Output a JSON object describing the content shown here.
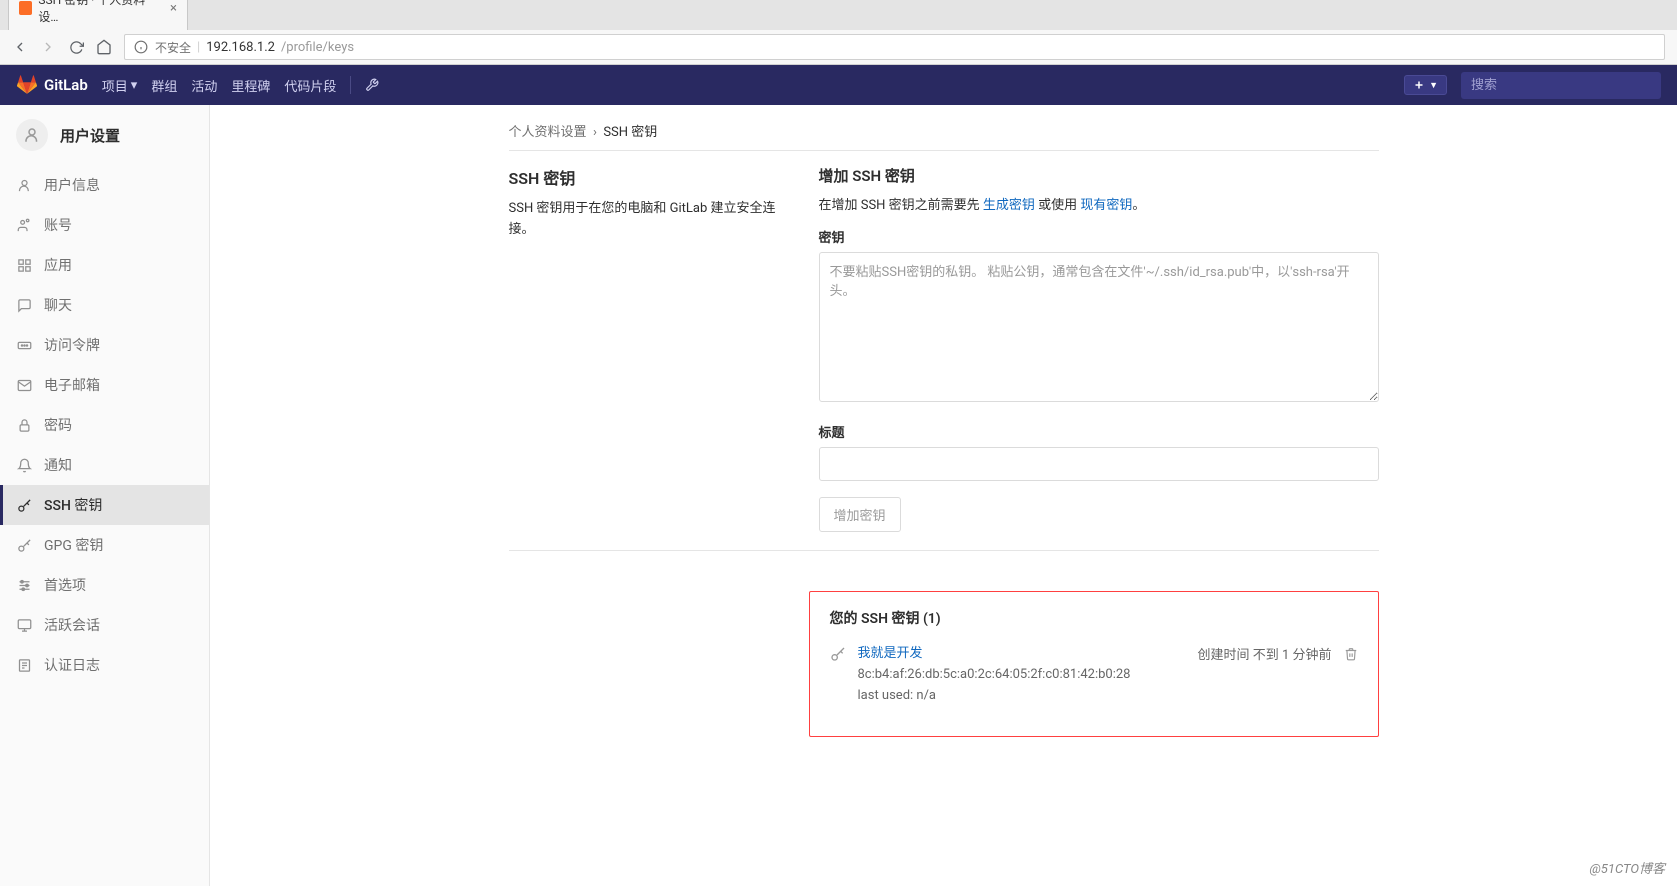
{
  "browser": {
    "tab_title": "SSH 密钥 · 个人资料设…",
    "security_label": "不安全",
    "url_host": "192.168.1.2",
    "url_path": "/profile/keys"
  },
  "header": {
    "brand": "GitLab",
    "nav": {
      "projects": "项目",
      "groups": "群组",
      "activity": "活动",
      "milestones": "里程碑",
      "snippets": "代码片段"
    },
    "search_placeholder": "搜索"
  },
  "sidebar": {
    "title": "用户设置",
    "items": [
      {
        "label": "用户信息"
      },
      {
        "label": "账号"
      },
      {
        "label": "应用"
      },
      {
        "label": "聊天"
      },
      {
        "label": "访问令牌"
      },
      {
        "label": "电子邮箱"
      },
      {
        "label": "密码"
      },
      {
        "label": "通知"
      },
      {
        "label": "SSH 密钥"
      },
      {
        "label": "GPG 密钥"
      },
      {
        "label": "首选项"
      },
      {
        "label": "活跃会话"
      },
      {
        "label": "认证日志"
      }
    ]
  },
  "breadcrumb": {
    "root": "个人资料设置",
    "sep": "›",
    "current": "SSH 密钥"
  },
  "intro": {
    "title": "SSH 密钥",
    "desc": "SSH 密钥用于在您的电脑和 GitLab 建立安全连接。"
  },
  "form": {
    "title": "增加 SSH 密钥",
    "help_prefix": "在增加 SSH 密钥之前需要先 ",
    "help_link1": "生成密钥",
    "help_mid": " 或使用 ",
    "help_link2": "现有密钥",
    "help_suffix": "。",
    "key_label": "密钥",
    "key_placeholder": "不要粘贴SSH密钥的私钥。 粘贴公钥，通常包含在文件'~/.ssh/id_rsa.pub'中，以'ssh-rsa'开头。",
    "title_label": "标题",
    "submit": "增加密钥"
  },
  "keylist": {
    "heading": "您的 SSH 密钥 (1)",
    "items": [
      {
        "name": "我就是开发",
        "fingerprint": "8c:b4:af:26:db:5c:a0:2c:64:05:2f:c0:81:42:b0:28",
        "last_used": "last used: n/a",
        "created": "创建时间 不到 1 分钟前"
      }
    ]
  },
  "watermark": "@51CTO博客"
}
